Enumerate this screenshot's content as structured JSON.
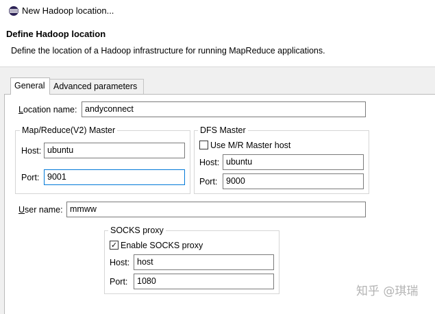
{
  "window": {
    "title": "New Hadoop location..."
  },
  "header": {
    "title": "Define Hadoop location",
    "description": "Define the location of a Hadoop infrastructure for running MapReduce applications."
  },
  "tabs": [
    {
      "label": "General",
      "active": true
    },
    {
      "label": "Advanced parameters",
      "active": false
    }
  ],
  "general": {
    "location_name": {
      "label_first": "L",
      "label_rest": "ocation name:",
      "value": "andyconnect"
    },
    "mr_master": {
      "legend": "Map/Reduce(V2) Master",
      "host_label": "Host:",
      "host_value": "ubuntu",
      "port_label": "Port:",
      "port_value": "9001"
    },
    "dfs_master": {
      "legend": "DFS Master",
      "use_mr_label": "Use M/R Master host",
      "use_mr_checked": false,
      "host_label": "Host:",
      "host_value": "ubuntu",
      "port_label": "Port:",
      "port_value": "9000"
    },
    "user_name": {
      "label_first": "U",
      "label_rest": "ser name:",
      "value": "mmww"
    },
    "socks_proxy": {
      "legend": "SOCKS proxy",
      "enable_label": "Enable SOCKS proxy",
      "enable_checked": true,
      "host_label": "Host:",
      "host_value": "host",
      "port_label": "Port:",
      "port_value": "1080"
    }
  },
  "watermark": "知乎 @琪瑞",
  "colors": {
    "focus_border": "#0078d7",
    "group_border": "#d5d5d5"
  }
}
